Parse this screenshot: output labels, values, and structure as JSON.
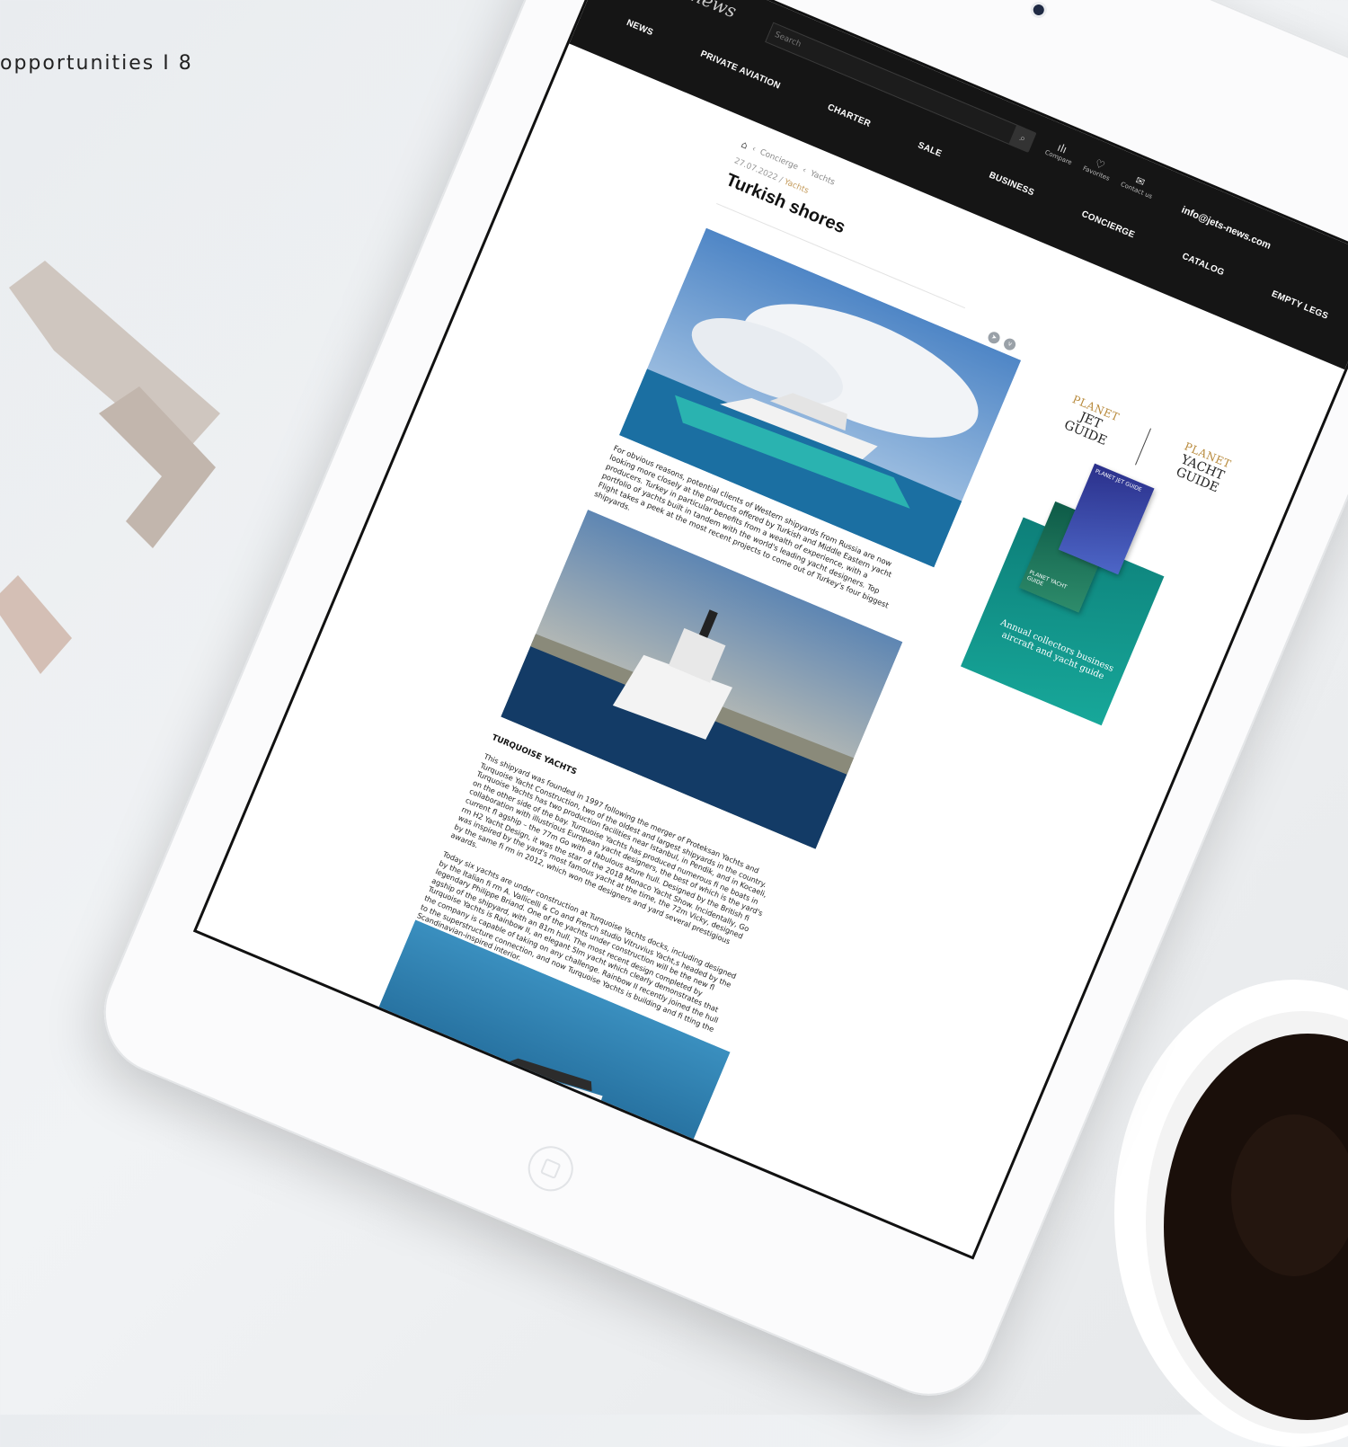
{
  "page": {
    "caption": "opportunities I 8"
  },
  "site": {
    "logo": "Jets-news",
    "search_placeholder": "Search",
    "email": "info@jets-news.com",
    "icons": [
      {
        "name": "compare-icon",
        "glyph": "ılı",
        "label": "Compare"
      },
      {
        "name": "favorites-icon",
        "glyph": "♡",
        "label": "Favorites"
      },
      {
        "name": "contact-icon",
        "glyph": "✉",
        "label": "Contact us"
      }
    ],
    "nav": [
      "NEWS",
      "PRIVATE AVIATION",
      "CHARTER",
      "SALE",
      "BUSINESS",
      "CONCIERGE",
      "CATALOG",
      "EMPTY LEGS"
    ]
  },
  "article": {
    "breadcrumb": [
      "Concierge",
      "Yachts"
    ],
    "date": "27.07.2022",
    "category": "Yachts",
    "title": "Turkish shores",
    "lead": "For obvious reasons, potential clients of Western shipyards from Russia are now looking more closely at the products offered by Turkish and Middle Eastern yacht producers. Turkey in particular benefits from a wealth of experience, with a portfolio of yachts built in tandem with the world's leading yacht designers. Top Flight takes a peek at the most recent projects to come out of Turkey's four biggest shipyards.",
    "section_heading": "TURQUOISE YACHTS",
    "para1": "This shipyard was founded in 1997 following the merger of Proteksan Yachts and Turquoise Yacht Construction, two of the oldest and largest shipyards in the country. Turquoise Yachts has two production facilities near Istanbul, in Pendik, and in Kocaeli, on the other side of the bay. Turquoise Yachts has produced numerous fi ne boats in collaboration with illustrious European yacht designers, the best of which is the yard's current fl agship – the 77m Go with a fabulous azure hull. Designed by the British fi rm H2 Yacht Design, it was the star of the 2018 Monaco Yacht Show. Incidentally, Go was inspired by the yard's most famous yacht at the time, the 72m Vicky, designed by the same fi rm in 2012, which won the designers and yard several prestigious awards.",
    "para2": "Today six yachts are under construction at Turquoise Yachts docks, including designed by the Italian fi rm A. Vallicelli & Co and French studio Vitruvius Yacht,s headed by the legendary Philippe Briand. One of the yachts under construction will be the new fl agship of the shipyard, with an 81m hull. The most recent design completed by Turquoise Yachts is Rainbow II, an elegant 5lm yacht which clearly demonstrates that the company is capable of taking on any challenge. Rainbow II recently joined the hull to the superstructure connection, and now Turquoise Yachts is building and fi tting the Scandinavian-inspired interior."
  },
  "ad": {
    "left_planet": "PLANET",
    "left_name": "JET",
    "left_guide": "GUIDE",
    "right_planet": "PLANET",
    "right_name": "YACHT",
    "right_guide": "GUIDE",
    "book1": "PLANET JET GUIDE",
    "book2": "PLANET YACHT GUIDE",
    "caption": "Annual collectors business aircraft and yacht guide"
  },
  "colors": {
    "topbar": "#151515",
    "accent_gold": "#c49b5b",
    "ad_teal": "#17a89a"
  }
}
